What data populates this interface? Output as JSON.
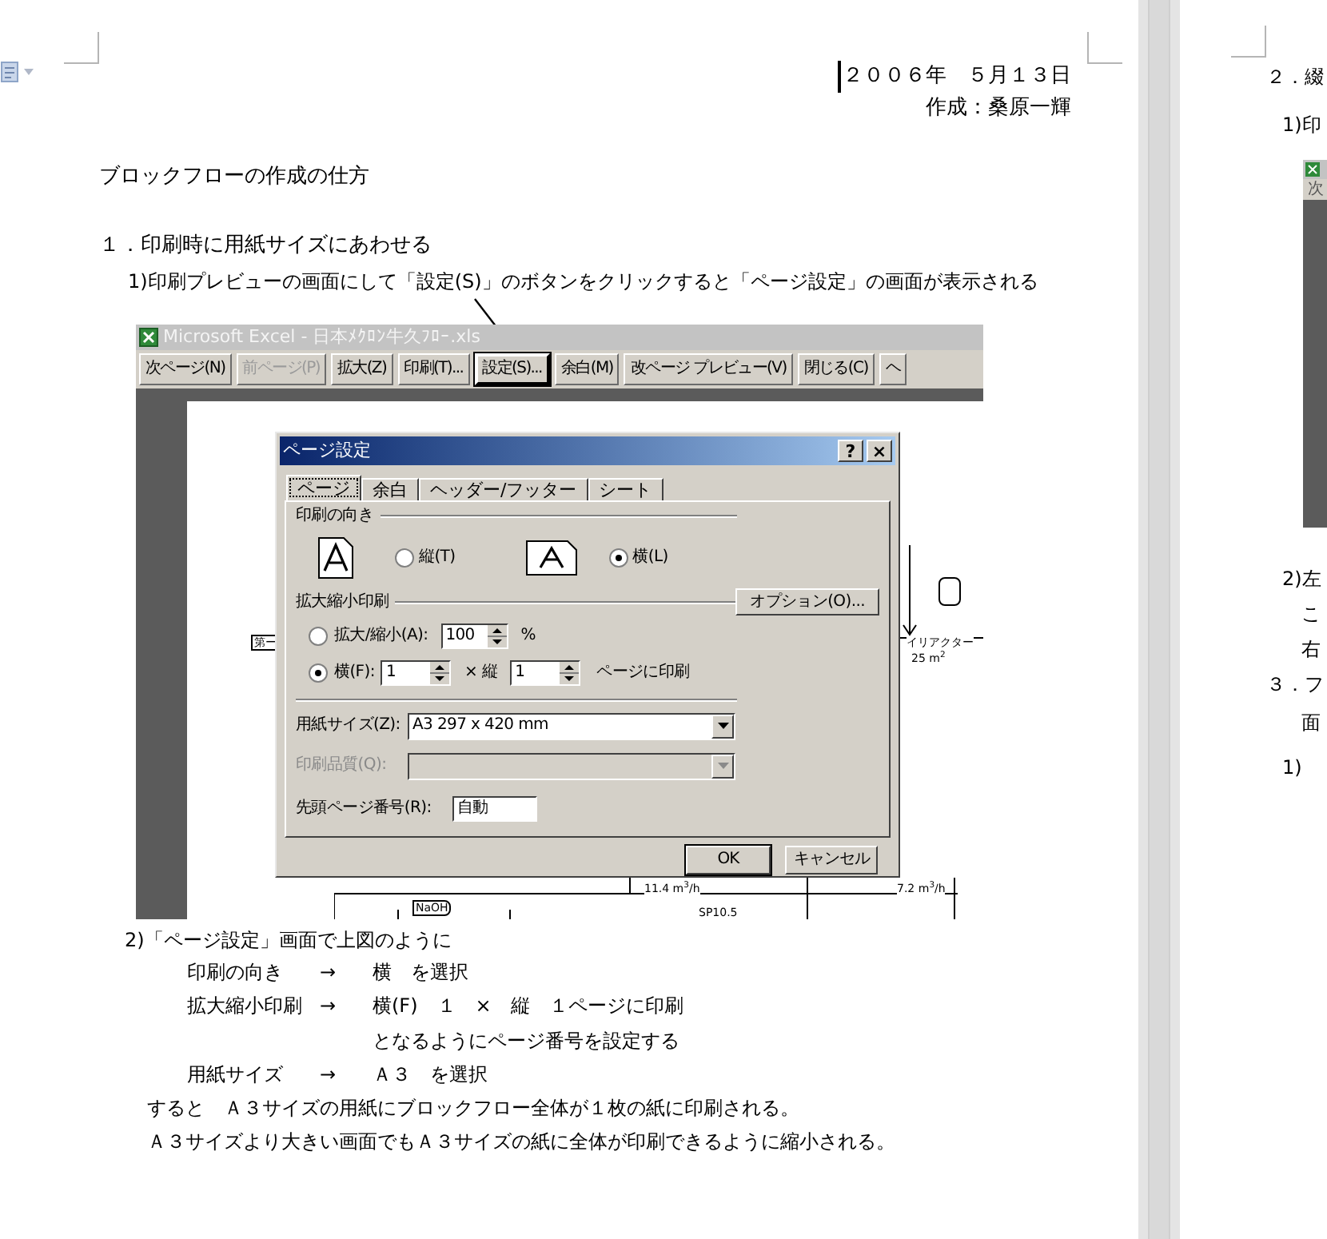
{
  "page_1": {
    "date": "２００６年　５月１３日",
    "author": "作成：桑原一輝",
    "title": "ブロックフローの作成の仕方",
    "heading": "１．印刷時に用紙サイズにあわせる",
    "step_1": "1)印刷プレビューの画面にして「設定(S)」のボタンをクリックすると「ページ設定」の画面が表示される",
    "screenshot": {
      "window_title": "Microsoft Excel - 日本ﾒｸﾛﾝ牛久ﾌﾛｰ.xls",
      "toolbar": [
        {
          "label": "次ページ(N)",
          "disabled": false,
          "focused": false
        },
        {
          "label": "前ページ(P)",
          "disabled": true,
          "focused": false
        },
        {
          "label": "拡大(Z)",
          "disabled": false,
          "focused": false
        },
        {
          "label": "印刷(T)...",
          "disabled": false,
          "focused": false
        },
        {
          "label": "設定(S)...",
          "disabled": false,
          "focused": true
        },
        {
          "label": "余白(M)",
          "disabled": false,
          "focused": false
        },
        {
          "label": "改ページ プレビュー(V)",
          "disabled": false,
          "focused": false
        },
        {
          "label": "閉じる(C)",
          "disabled": false,
          "focused": false
        },
        {
          "label": "ヘ",
          "disabled": false,
          "focused": false
        }
      ],
      "diagram_labels": [
        "第ー",
        "イリアクター",
        "25 m$^{2}$",
        "11.4 m$^{3}$/h",
        "7.2 m$^{3}$/h",
        "NaOH",
        "SP10.5"
      ],
      "dialog": {
        "title": "ページ設定",
        "help": "?",
        "close": "×",
        "tabs": [
          {
            "label": "ページ",
            "selected": true
          },
          {
            "label": "余白",
            "selected": false
          },
          {
            "label": "ヘッダー/フッター",
            "selected": false
          },
          {
            "label": "シート",
            "selected": false
          }
        ],
        "orientation": {
          "label": "印刷の向き",
          "options": [
            {
              "label": "縦(T)",
              "selected": false
            },
            {
              "label": "横(L)",
              "selected": true
            }
          ]
        },
        "scaling": {
          "label": "拡大縮小印刷",
          "options_button": "オプション(O)...",
          "options": [
            {
              "kind": "percent",
              "label": "拡大/縮小(A):",
              "value": "100",
              "suffix": "%",
              "selected": false
            },
            {
              "kind": "fit",
              "label": "横(F):",
              "value": "1",
              "middle": "× 縦",
              "value_2": "1",
              "suffix": "ページに印刷",
              "selected": true
            }
          ]
        },
        "paper_size": {
          "label": "用紙サイズ(Z):",
          "value": "A3 297 x 420 mm",
          "disabled": false
        },
        "print_quality": {
          "label": "印刷品質(Q):",
          "disabled": true
        },
        "first_page": {
          "label": "先頭ページ番号(R):",
          "value": "自動"
        },
        "buttons": [
          "OK",
          "キャンセル"
        ]
      }
    },
    "step_2": "2)「ページ設定」画面で上図のように",
    "settings": [
      {
        "label": "印刷の向き",
        "arrow": "→",
        "value": "横　を選択"
      },
      {
        "label": "拡大縮小印刷",
        "arrow": "→",
        "value": "横(F)　１　×　縦　１ページに印刷"
      }
    ],
    "continuation": "となるようにページ番号を設定する",
    "settings_2": [
      {
        "label": "用紙サイズ",
        "arrow": "→",
        "value": "Ａ３　を選択"
      }
    ],
    "paragraphs": [
      "すると　Ａ３サイズの用紙にブロックフロー全体が１枚の紙に印刷される。",
      "Ａ３サイズより大きい画面でもＡ３サイズの紙に全体が印刷できるように縮小される。"
    ]
  },
  "page_2": {
    "lines": [
      {
        "kind": "heading",
        "text": "２．綴"
      },
      {
        "kind": "step",
        "text": "1)印"
      },
      {
        "kind": "screenshot",
        "text": "次"
      },
      {
        "kind": "step",
        "text": "2)左"
      },
      {
        "kind": "indent",
        "text": "こ"
      },
      {
        "kind": "indent",
        "text": "右"
      },
      {
        "kind": "heading",
        "text": "３．フ"
      },
      {
        "kind": "indent",
        "text": "面"
      },
      {
        "kind": "step",
        "text": "1)"
      }
    ]
  }
}
